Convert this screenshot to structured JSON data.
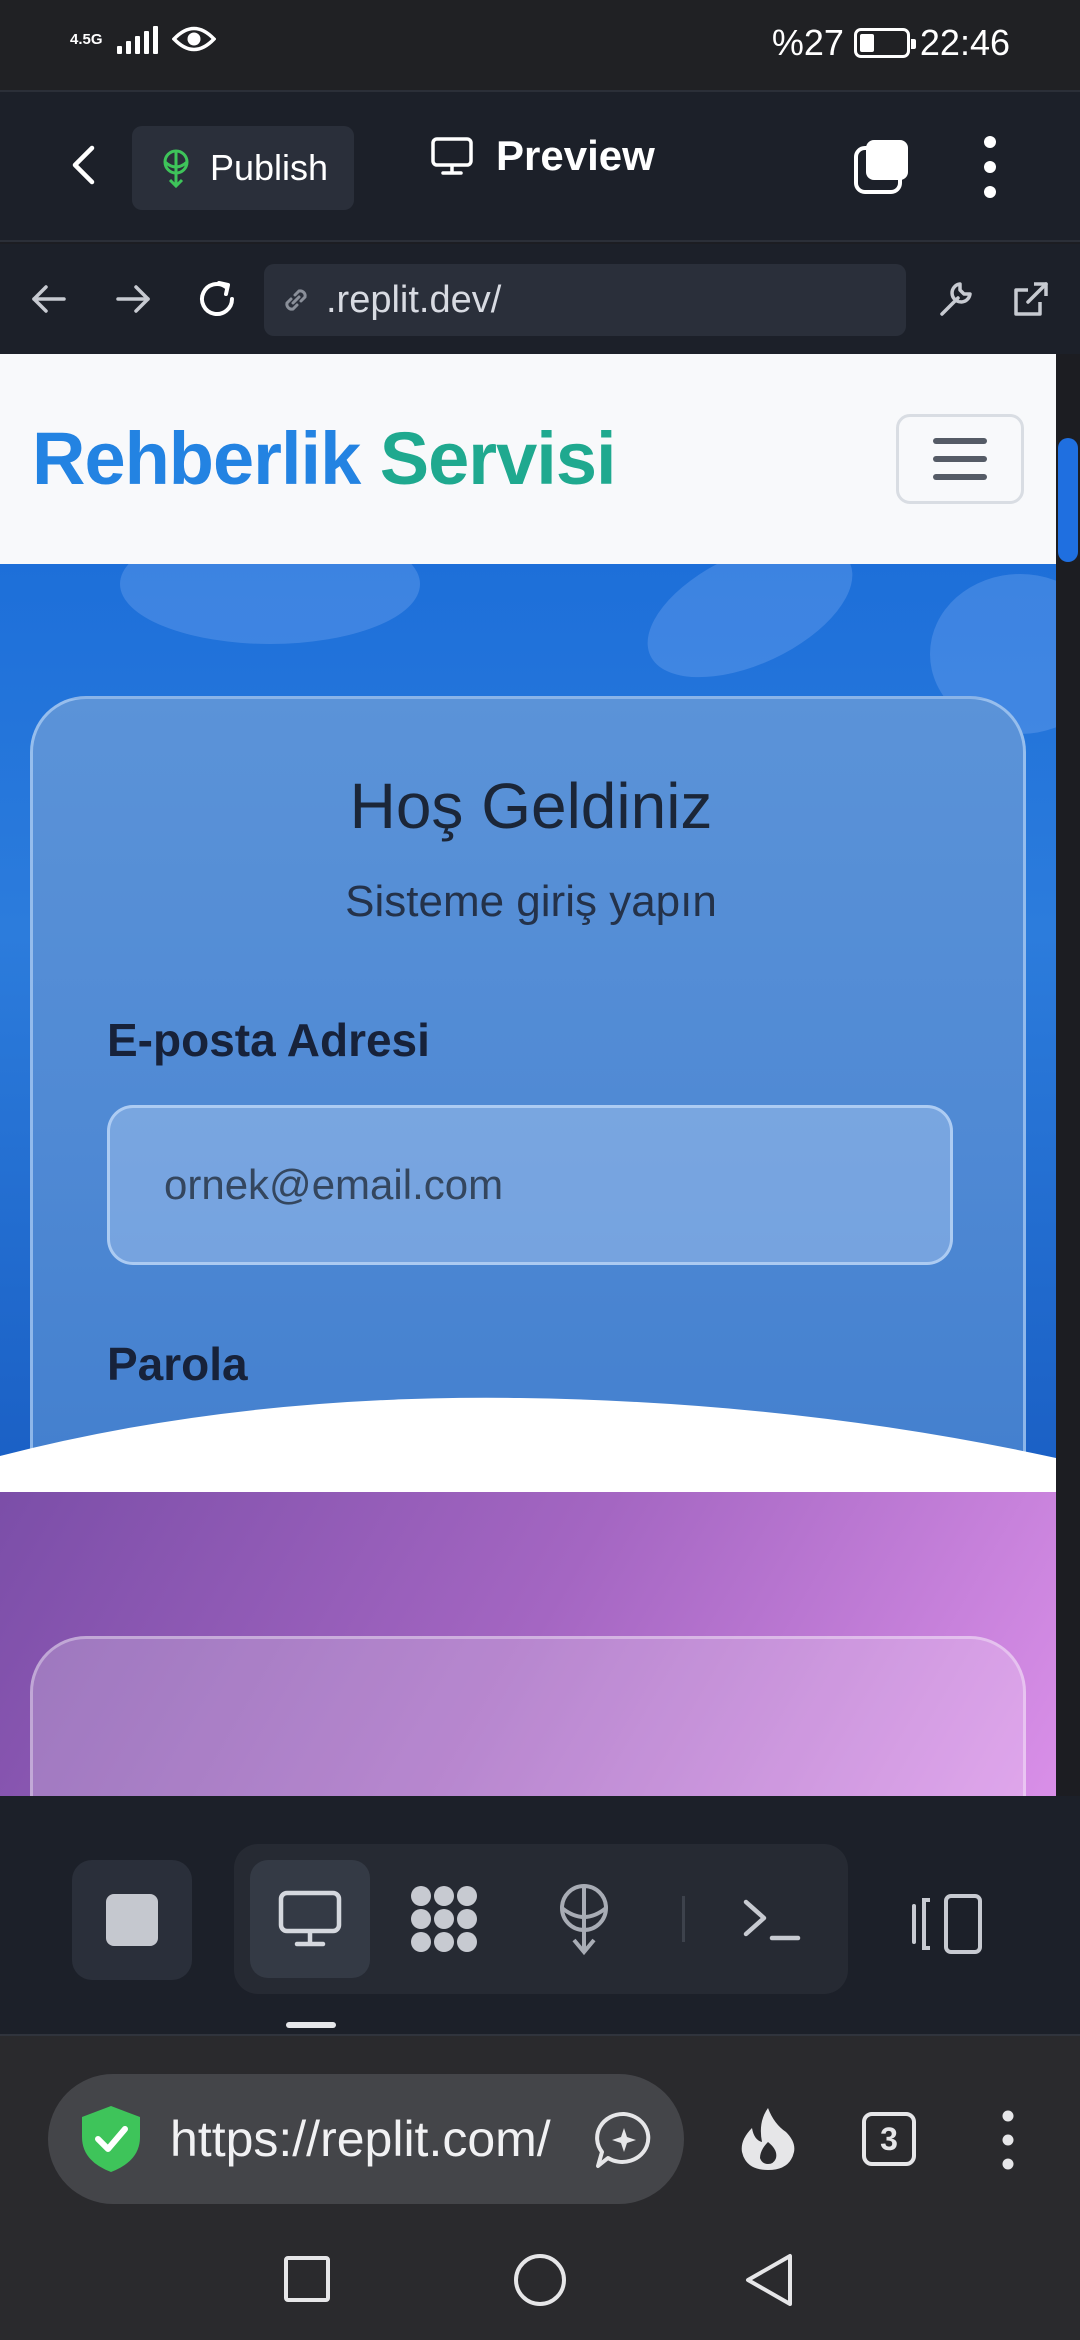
{
  "status_bar": {
    "network": "4.5G",
    "battery": "%27",
    "time": "22:46"
  },
  "replit_header": {
    "publish_label": "Publish",
    "preview_label": "Preview"
  },
  "preview_url": {
    "text": ".replit.dev/"
  },
  "site": {
    "brand_part1": "Rehberlik",
    "brand_part2": "Servisi",
    "login": {
      "title": "Hoş Geldiniz",
      "subtitle": "Sisteme giriş yapın",
      "email_label": "E-posta Adresi",
      "email_placeholder": "ornek@email.com",
      "password_label": "Parola"
    }
  },
  "browser": {
    "url": "https://replit.com/",
    "tab_count": "3"
  },
  "colors": {
    "brand_blue": "#2383e2",
    "brand_teal": "#1fa98f",
    "hero_blue": "#1d6fd9",
    "secure_green": "#3ec45a"
  }
}
